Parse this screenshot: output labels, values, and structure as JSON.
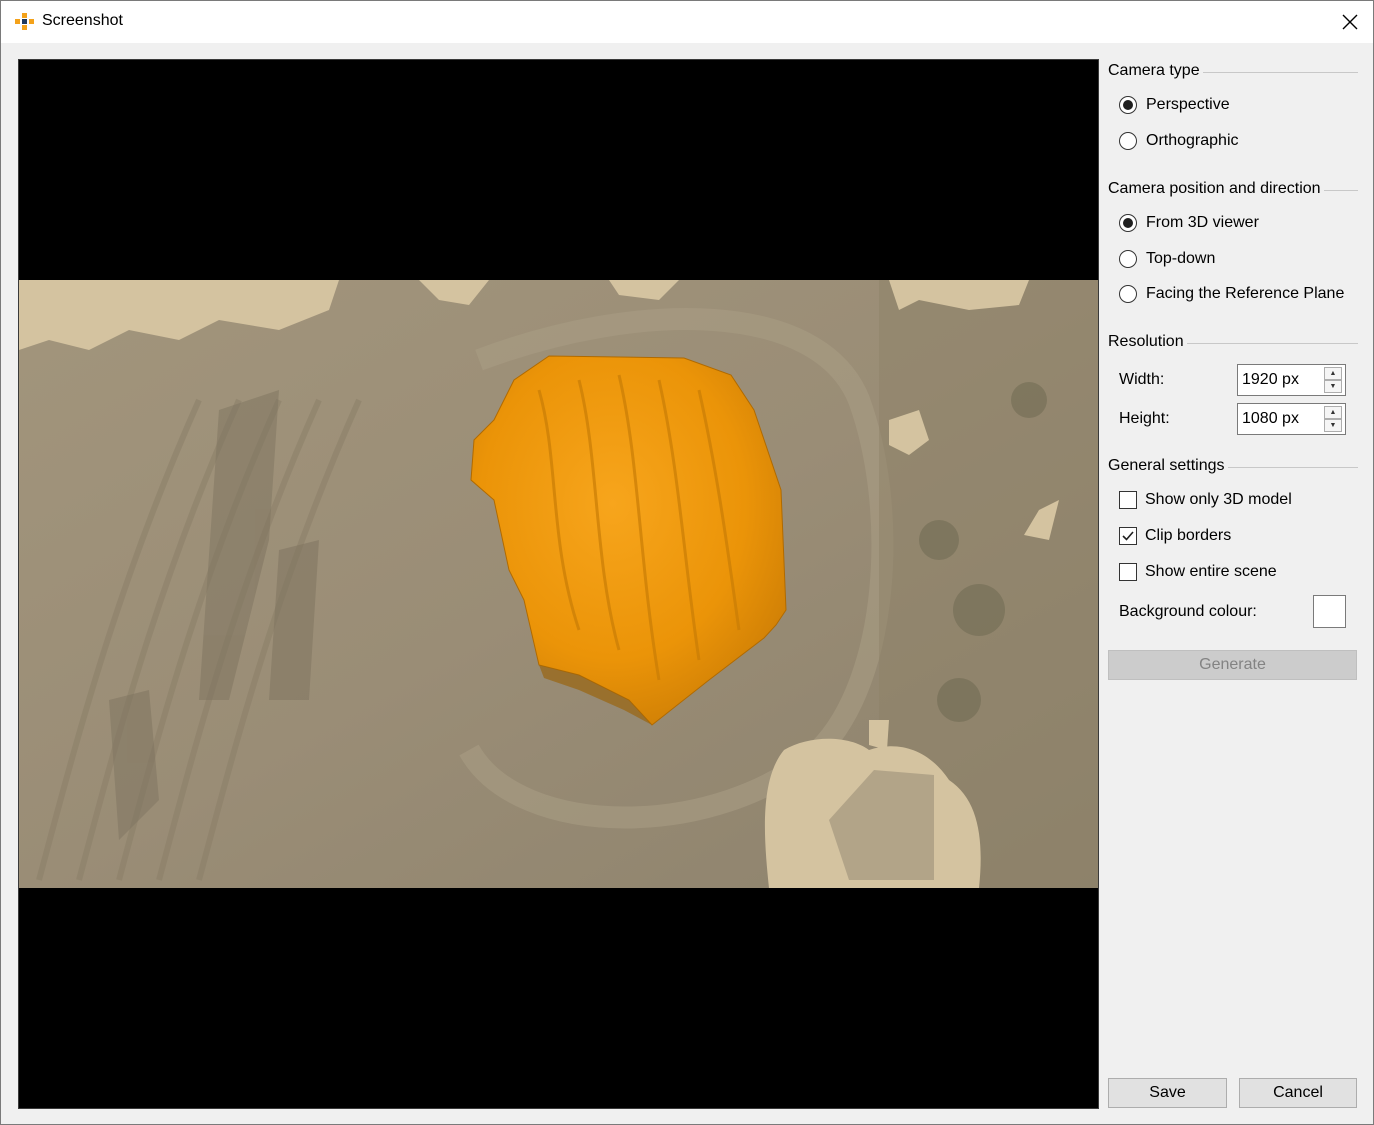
{
  "window": {
    "title": "Screenshot"
  },
  "camera_type": {
    "label": "Camera type",
    "options": [
      {
        "label": "Perspective",
        "selected": true
      },
      {
        "label": "Orthographic",
        "selected": false
      }
    ]
  },
  "camera_position": {
    "label": "Camera position and direction",
    "options": [
      {
        "label": "From 3D viewer",
        "selected": true
      },
      {
        "label": "Top-down",
        "selected": false
      },
      {
        "label": "Facing the Reference Plane",
        "selected": false
      }
    ]
  },
  "resolution": {
    "label": "Resolution",
    "width_label": "Width:",
    "width_value": "1920 px",
    "height_label": "Height:",
    "height_value": "1080 px"
  },
  "general_settings": {
    "label": "General settings",
    "show_only_3d_model": {
      "label": "Show only 3D model",
      "checked": false
    },
    "clip_borders": {
      "label": "Clip borders",
      "checked": true
    },
    "show_entire_scene": {
      "label": "Show entire scene",
      "checked": false
    },
    "background_colour_label": "Background colour:",
    "background_colour": "#ffffff"
  },
  "buttons": {
    "generate": "Generate",
    "save": "Save",
    "cancel": "Cancel"
  },
  "colors": {
    "highlight": "#f29b0c",
    "terrain": "#9b8f78",
    "masked_area": "#d4c3a0",
    "letterbox": "#000000"
  }
}
